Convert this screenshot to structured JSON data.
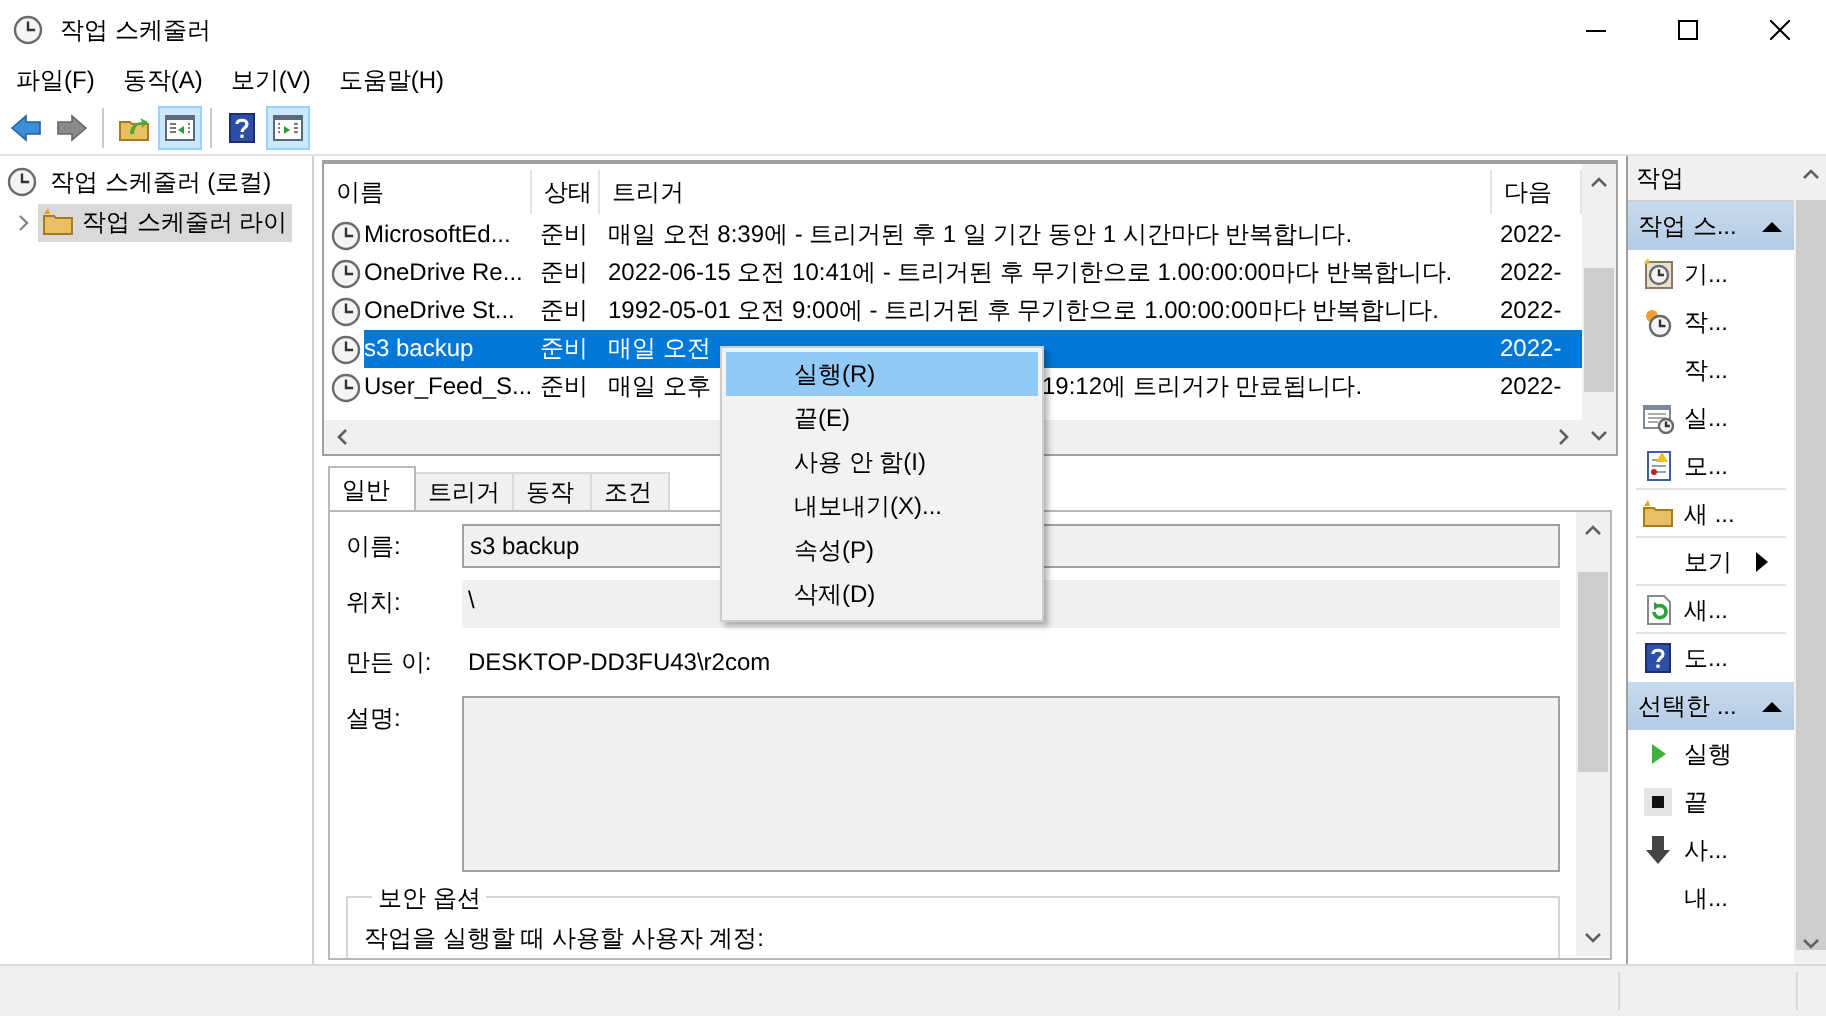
{
  "window": {
    "title": "작업 스케줄러"
  },
  "menu": [
    {
      "label": "파일(F)"
    },
    {
      "label": "동작(A)"
    },
    {
      "label": "보기(V)"
    },
    {
      "label": "도움말(H)"
    }
  ],
  "toolbar": [
    {
      "kind": "back",
      "pressed": false
    },
    {
      "kind": "forward",
      "pressed": false
    },
    {
      "kind": "separator"
    },
    {
      "kind": "folder-up",
      "pressed": false
    },
    {
      "kind": "left-pane",
      "pressed": true
    },
    {
      "kind": "separator"
    },
    {
      "kind": "help",
      "pressed": false
    },
    {
      "kind": "right-pane",
      "pressed": true
    }
  ],
  "tree": [
    {
      "label": "작업 스케줄러 (로컬)",
      "selected": false,
      "children": [
        {
          "label": "작업 스케줄러 라이",
          "selected": true,
          "expanded": false
        }
      ]
    }
  ],
  "task_table": {
    "columns": [
      "이름",
      "상태",
      "트리거",
      "다음"
    ],
    "rows": [
      {
        "name": "MicrosoftEd...",
        "status": "준비",
        "trigger": "매일 오전 8:39에 - 트리거된 후 1 일 기간 동안 1 시간마다 반복합니다.",
        "next": "2022-",
        "selected": false
      },
      {
        "name": "OneDrive Re...",
        "status": "준비",
        "trigger": "2022-06-15 오전 10:41에 - 트리거된 후 무기한으로 1.00:00:00마다 반복합니다.",
        "next": "2022-",
        "selected": false
      },
      {
        "name": "OneDrive St...",
        "status": "준비",
        "trigger": "1992-05-01 오전 9:00에 - 트리거된 후 무기한으로 1.00:00:00마다 반복합니다.",
        "next": "2022-",
        "selected": false
      },
      {
        "name": "s3 backup",
        "status": "준비",
        "trigger": "매일 오전",
        "next": "2022-",
        "selected": true
      },
      {
        "name": "User_Feed_S...",
        "status": "준비",
        "trigger": "매일 오후",
        "trigger_tail": "19:12에 트리거가 만료됩니다.",
        "next": "2022-",
        "selected": false
      }
    ]
  },
  "context_menu": {
    "items": [
      {
        "label": "실행(R)",
        "selected": true
      },
      {
        "label": "끝(E)",
        "selected": false
      },
      {
        "label": "사용 안 함(I)",
        "selected": false
      },
      {
        "label": "내보내기(X)...",
        "selected": false
      },
      {
        "label": "속성(P)",
        "selected": false
      },
      {
        "label": "삭제(D)",
        "selected": false
      }
    ]
  },
  "details": {
    "tabs": [
      {
        "label": "일반",
        "selected": true
      },
      {
        "label": "트리거",
        "selected": false
      },
      {
        "label": "동작",
        "selected": false
      },
      {
        "label": "조건",
        "selected": false
      }
    ],
    "fields": [
      {
        "label": "이름:",
        "value": "s3 backup",
        "kind": "input"
      },
      {
        "label": "위치:",
        "value": "\\",
        "kind": "readonly"
      },
      {
        "label": "만든 이:",
        "value": "DESKTOP-DD3FU43\\r2com",
        "kind": "text"
      },
      {
        "label": "설명:",
        "kind": "textarea"
      }
    ],
    "security": {
      "title": "보안 옵션",
      "text": "작업을 실행할 때 사용할 사용자 계정:"
    }
  },
  "actions": {
    "title": "작업",
    "sections": [
      {
        "title": "작업 스...",
        "expanded": true,
        "items": [
          {
            "label": "기...",
            "kind": "clock-star",
            "separator": false,
            "submenu": false
          },
          {
            "label": "작...",
            "kind": "clock-small",
            "separator": false,
            "submenu": false
          },
          {
            "label": "작...",
            "kind": "plain",
            "separator": false,
            "submenu": false
          },
          {
            "label": "실...",
            "kind": "calendar-clock",
            "separator": false,
            "submenu": false
          },
          {
            "label": "모...",
            "kind": "log",
            "separator": true,
            "submenu": false
          },
          {
            "label": "새 ...",
            "kind": "folder-new",
            "separator": true,
            "submenu": false
          },
          {
            "label": "보기",
            "kind": "plain",
            "separator": true,
            "submenu": true
          },
          {
            "label": "새...",
            "kind": "refresh",
            "separator": true,
            "submenu": false
          },
          {
            "label": "도...",
            "kind": "help",
            "separator": false,
            "submenu": false
          }
        ]
      },
      {
        "title": "선택한 ...",
        "expanded": true,
        "items": [
          {
            "label": "실행",
            "kind": "play",
            "separator": false,
            "submenu": false
          },
          {
            "label": "끝",
            "kind": "stop",
            "separator": false,
            "submenu": false
          },
          {
            "label": "사...",
            "kind": "down-arrow",
            "separator": false,
            "submenu": false
          },
          {
            "label": "내...",
            "kind": "plain",
            "separator": false,
            "submenu": false
          }
        ]
      }
    ]
  }
}
